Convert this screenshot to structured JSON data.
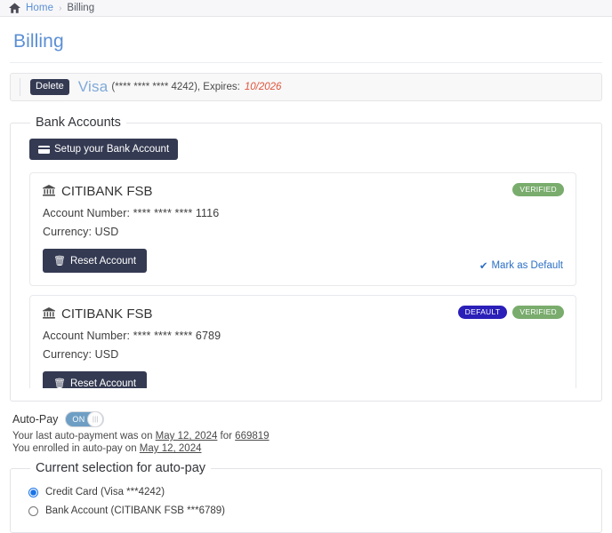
{
  "breadcrumb": {
    "home_icon": "home-icon",
    "home": "Home",
    "separator": "›",
    "current": "Billing"
  },
  "page": {
    "title": "Billing"
  },
  "credit_card": {
    "delete_label": "Delete",
    "brand": "Visa",
    "masked": "(**** **** **** 4242), Expires:",
    "expires": "10/2026"
  },
  "bank_accounts": {
    "legend": "Bank Accounts",
    "setup_button": "Setup your Bank Account",
    "setup_icon": "credit-card-icon",
    "cards": [
      {
        "bank_icon": "bank-icon",
        "name": "CITIBANK FSB",
        "account_number": "Account Number: **** **** **** 1116",
        "currency": "Currency: USD",
        "reset_label": "Reset Account",
        "trash_icon": "trash-icon",
        "badges": [
          "VERIFIED"
        ],
        "mark_default": "Mark as Default",
        "check_icon": "check-icon"
      },
      {
        "bank_icon": "bank-icon",
        "name": "CITIBANK FSB",
        "account_number": "Account Number: **** **** **** 6789",
        "currency": "Currency: USD",
        "reset_label": "Reset Account",
        "trash_icon": "trash-icon",
        "badges": [
          "DEFAULT",
          "VERIFIED"
        ]
      }
    ]
  },
  "autopay": {
    "label": "Auto-Pay",
    "toggle_state": "ON",
    "toggle_knob": "|||",
    "last_payment_prefix": "Your last auto-payment was on ",
    "last_payment_date": "May 12, 2024",
    "last_payment_mid": " for ",
    "last_payment_ref": "669819",
    "enrolled_prefix": "You enrolled in auto-pay on ",
    "enrolled_date": "May 12, 2024"
  },
  "current_selection": {
    "legend": "Current selection for auto-pay",
    "options": [
      {
        "label": "Credit Card (Visa ***4242)",
        "selected": true
      },
      {
        "label": "Bank Account (CITIBANK FSB ***6789)",
        "selected": false
      }
    ]
  },
  "colors": {
    "accent_blue": "#5b8fd4",
    "dark_button": "#343a52",
    "badge_verified": "#79ac6d",
    "badge_default": "#2a1fb8",
    "expires_red": "#e0553c",
    "toggle_on": "#6e9ec4"
  }
}
